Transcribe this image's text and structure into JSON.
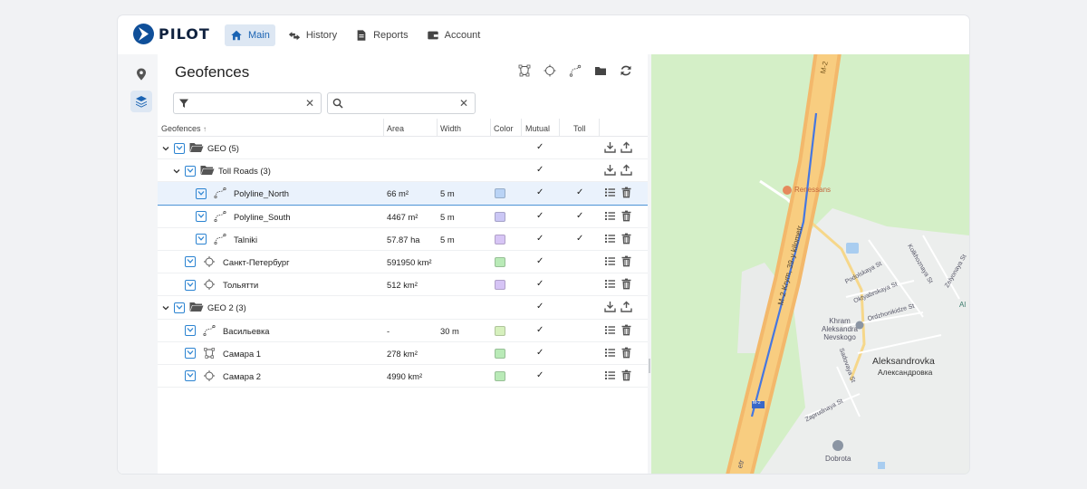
{
  "brand": {
    "name": "PILOT"
  },
  "nav": [
    {
      "label": "Main",
      "icon": "home-icon",
      "active": true
    },
    {
      "label": "History",
      "icon": "history-icon",
      "active": false
    },
    {
      "label": "Reports",
      "icon": "document-icon",
      "active": false
    },
    {
      "label": "Account",
      "icon": "wallet-icon",
      "active": false
    }
  ],
  "rail": [
    {
      "icon": "map-pin-icon",
      "active": false
    },
    {
      "icon": "layers-icon",
      "active": true
    }
  ],
  "panel": {
    "title": "Geofences",
    "filter_value": "",
    "search_value": ""
  },
  "columns": {
    "name": "Geofences",
    "area": "Area",
    "width": "Width",
    "color": "Color",
    "mutual": "Mutual",
    "toll": "Toll"
  },
  "rows": [
    {
      "level": 0,
      "type": "group",
      "name": "GEO (5)",
      "area": "",
      "width": "",
      "color": "",
      "mutual": "✓",
      "toll": ""
    },
    {
      "level": 1,
      "type": "group",
      "name": "Toll Roads (3)",
      "area": "",
      "width": "",
      "color": "",
      "mutual": "✓",
      "toll": ""
    },
    {
      "level": 2,
      "type": "polyline",
      "name": "Polyline_North",
      "area": "66 m²",
      "width": "5 m",
      "color": "#b9d3f5",
      "mutual": "✓",
      "toll": "✓",
      "selected": true
    },
    {
      "level": 2,
      "type": "polyline",
      "name": "Polyline_South",
      "area": "4467 m²",
      "width": "5 m",
      "color": "#cbc7f5",
      "mutual": "✓",
      "toll": "✓"
    },
    {
      "level": 2,
      "type": "polyline",
      "name": "Talniki",
      "area": "57.87 ha",
      "width": "5 m",
      "color": "#d7c5f5",
      "mutual": "✓",
      "toll": "✓"
    },
    {
      "level": 1,
      "type": "circle",
      "name": "Санкт-Петербург",
      "area": "591950 km²",
      "width": "",
      "color": "#b9eab7",
      "mutual": "✓",
      "toll": ""
    },
    {
      "level": 1,
      "type": "circle",
      "name": "Тольятти",
      "area": "512 km²",
      "width": "",
      "color": "#d6c4f5",
      "mutual": "✓",
      "toll": ""
    },
    {
      "level": 0,
      "type": "group",
      "name": "GEO 2 (3)",
      "area": "",
      "width": "",
      "color": "",
      "mutual": "✓",
      "toll": ""
    },
    {
      "level": 1,
      "type": "polyline",
      "name": "Васильевка",
      "area": "-",
      "width": "30 m",
      "color": "#d6f0bd",
      "mutual": "✓",
      "toll": ""
    },
    {
      "level": 1,
      "type": "polygon",
      "name": "Самара 1",
      "area": "278 km²",
      "width": "",
      "color": "#b9eab7",
      "mutual": "✓",
      "toll": ""
    },
    {
      "level": 1,
      "type": "circle",
      "name": "Самара 2",
      "area": "4990 km²",
      "width": "",
      "color": "#b9eab7",
      "mutual": "✓",
      "toll": ""
    }
  ],
  "map": {
    "labels": {
      "road_top": "M-2",
      "road_mid": "M-2 Krym, 39-y kilometr",
      "poi": "Renessans",
      "village_en": "Aleksandrovka",
      "village_ru": "Александровка",
      "church": "Khram Aleksandra Nevskogo",
      "street1": "Podolskaya St",
      "street2": "Oktyabrskaya St",
      "street3": "Ordzhonikidze St",
      "street4": "Kolkhoznaya St",
      "street5": "Zelyonaya St",
      "street6": "Sadovaya St",
      "street7": "Zaprudnaya St",
      "dobrota": "Dobrota",
      "road_bottom": "etr",
      "al": "Al",
      "shield": "M-2"
    }
  }
}
